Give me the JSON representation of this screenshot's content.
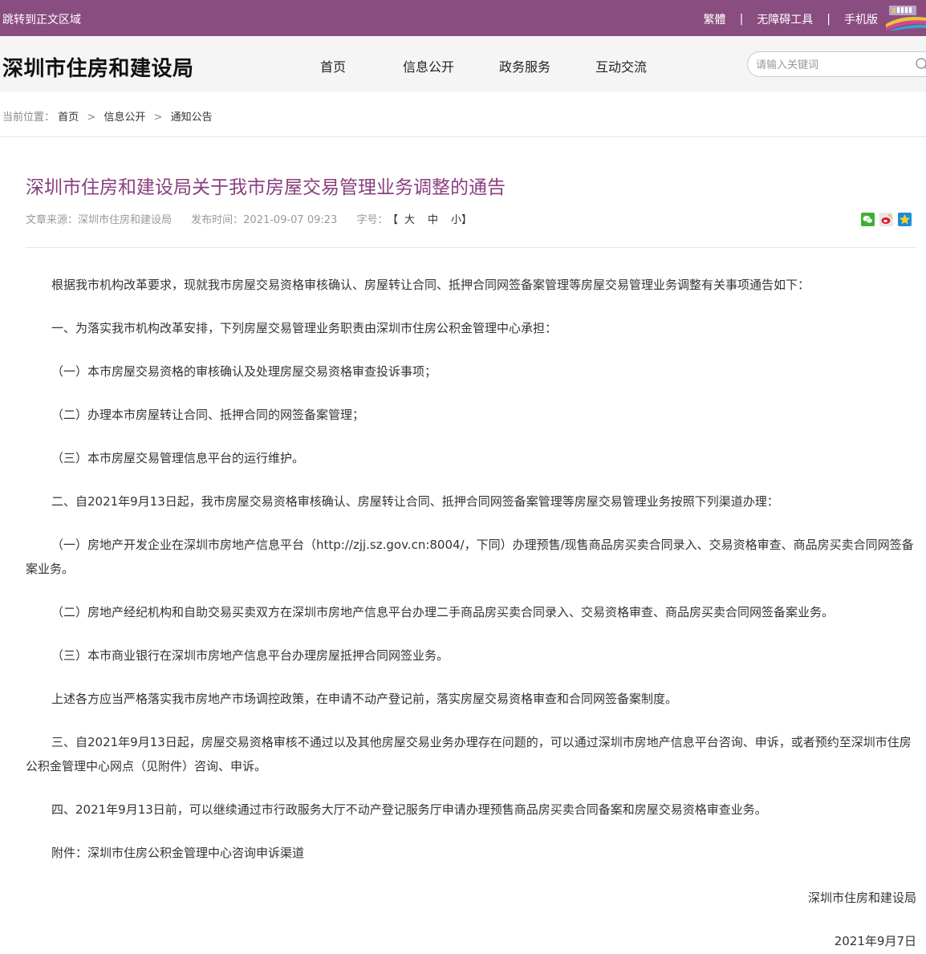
{
  "topbar": {
    "skip_link": "跳转到正文区域",
    "traditional": "繁體",
    "accessibility": "无障碍工具",
    "mobile": "手机版",
    "separator": "|"
  },
  "header": {
    "site_title": "深圳市住房和建设局",
    "nav": [
      "首页",
      "信息公开",
      "政务服务",
      "互动交流"
    ],
    "search_placeholder": "请输入关键词"
  },
  "breadcrumb": {
    "label": "当前位置：",
    "items": [
      "首页",
      "信息公开",
      "通知公告"
    ],
    "arrow": ">"
  },
  "article": {
    "title": "深圳市住房和建设局关于我市房屋交易管理业务调整的通告",
    "source": "文章来源：深圳市住房和建设局",
    "publish_time": "发布时间：2021-09-07 09:23",
    "font_label": "字号：",
    "bracket_open": "【",
    "bracket_close": "】",
    "font_sizes": [
      "大",
      "中",
      "小"
    ],
    "paragraphs": [
      "根据我市机构改革要求，现就我市房屋交易资格审核确认、房屋转让合同、抵押合同网签备案管理等房屋交易管理业务调整有关事项通告如下：",
      "一、为落实我市机构改革安排，下列房屋交易管理业务职责由深圳市住房公积金管理中心承担：",
      "（一）本市房屋交易资格的审核确认及处理房屋交易资格审查投诉事项；",
      "（二）办理本市房屋转让合同、抵押合同的网签备案管理；",
      "（三）本市房屋交易管理信息平台的运行维护。",
      "二、自2021年9月13日起，我市房屋交易资格审核确认、房屋转让合同、抵押合同网签备案管理等房屋交易管理业务按照下列渠道办理：",
      "（一）房地产开发企业在深圳市房地产信息平台（http://zjj.sz.gov.cn:8004/，下同）办理预售/现售商品房买卖合同录入、交易资格审查、商品房买卖合同网签备案业务。",
      "（二）房地产经纪机构和自助交易买卖双方在深圳市房地产信息平台办理二手商品房买卖合同录入、交易资格审查、商品房买卖合同网签备案业务。",
      "（三）本市商业银行在深圳市房地产信息平台办理房屋抵押合同网签业务。",
      "上述各方应当严格落实我市房地产市场调控政策，在申请不动产登记前，落实房屋交易资格审查和合同网签备案制度。",
      "三、自2021年9月13日起，房屋交易资格审核不通过以及其他房屋交易业务办理存在问题的，可以通过深圳市房地产信息平台咨询、申诉，或者预约至深圳市住房公积金管理中心网点（见附件）咨询、申诉。",
      "四、2021年9月13日前，可以继续通过市行政服务大厅不动产登记服务厅申请办理预售商品房买卖合同备案和房屋交易资格审查业务。",
      "附件：深圳市住房公积金管理中心咨询申诉渠道"
    ],
    "signature": "深圳市住房和建设局",
    "date": "2021年9月7日"
  },
  "colors": {
    "topbar": "#8a4d7f",
    "title": "#8a3f7e",
    "header_bg": "#f5f5f5"
  },
  "icons": {
    "share": [
      "wechat-icon",
      "weibo-icon",
      "qzone-icon"
    ],
    "search": "search-icon"
  }
}
